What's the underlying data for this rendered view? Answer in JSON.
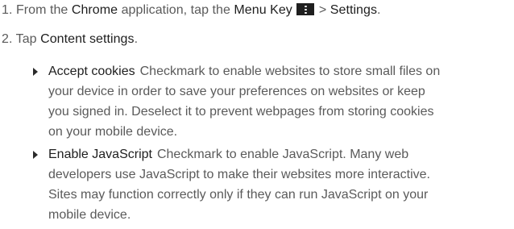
{
  "steps": [
    {
      "number": "1.",
      "text_a": "From the",
      "app": "Chrome",
      "text_b": "application, tap the",
      "menu_key": "Menu Key",
      "sep": ">",
      "settings": "Settings",
      "end": "."
    },
    {
      "number": "2.",
      "text_a": "Tap",
      "content_settings": "Content settings",
      "end": "."
    }
  ],
  "bullets": [
    {
      "term": "Accept cookies",
      "lines": [
        "Checkmark to enable websites to store small files on",
        "your device in order to save your preferences on websites or keep",
        "you signed in. Deselect it to prevent webpages from storing cookies",
        "on your mobile device."
      ]
    },
    {
      "term": "Enable JavaScript",
      "lines": [
        "Checkmark to enable JavaScript. Many web",
        "developers use JavaScript to make their websites more interactive.",
        "Sites may function correctly only if they can run JavaScript on your",
        "mobile device."
      ]
    }
  ],
  "icons": {
    "menu_key_icon": "vertical-ellipsis-icon",
    "bullet_icon": "triangle-right-icon"
  },
  "colors": {
    "body_text": "#5a5a5a",
    "emphasis_text": "#1e1e1e",
    "menu_key_bg": "#1f1f1f"
  }
}
